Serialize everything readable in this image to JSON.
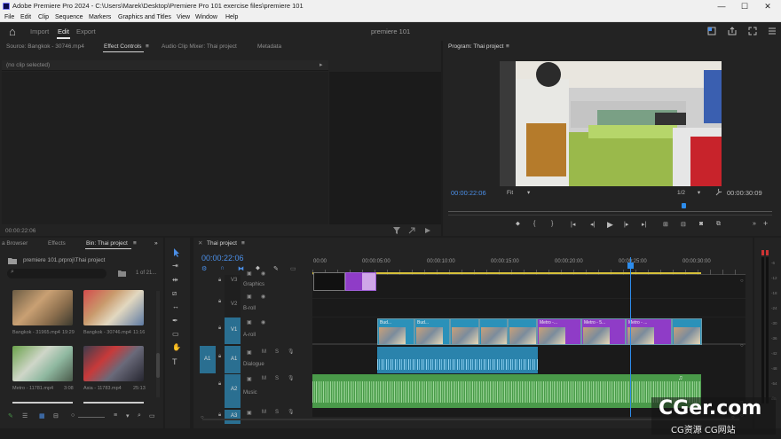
{
  "window": {
    "title": "Adobe Premiere Pro 2024 - C:\\Users\\Marek\\Desktop\\Premiere Pro 101 exercise files\\premiere 101",
    "minimize": "—",
    "maximize": "☐",
    "close": "✕"
  },
  "menu": [
    "File",
    "Edit",
    "Clip",
    "Sequence",
    "Markers",
    "Graphics and Titles",
    "View",
    "Window",
    "Help"
  ],
  "header": {
    "home": "⌂",
    "import": "Import",
    "edit": "Edit",
    "export": "Export",
    "project_name": "premiere 101"
  },
  "source_panel": {
    "tabs": [
      "Source: Bangkok - 30746.mp4",
      "Effect Controls",
      "Audio Clip Mixer: Thai project",
      "Metadata"
    ],
    "menu_glyph": "≡",
    "no_clip": "(no clip selected)",
    "timecode": "00:00:22:06"
  },
  "program_panel": {
    "tab": "Program: Thai project",
    "menu_glyph": "≡",
    "timecode": "00:00:22:06",
    "fit": "Fit",
    "quality": "1/2",
    "duration": "00:00:30:09"
  },
  "bin_panel": {
    "tabs": [
      "a Browser",
      "Effects",
      "Bin: Thai project"
    ],
    "menu_glyph": "≡",
    "expand": "»",
    "path": "premiere 101.prproj\\Thai project",
    "page": "1 of 21...",
    "items": [
      {
        "name": "Bangkok - 31965.mp4",
        "duration": "19:29"
      },
      {
        "name": "Bangkok - 30746.mp4",
        "duration": "11:16"
      },
      {
        "name": "Metro - 11781.mp4",
        "duration": "3:08"
      },
      {
        "name": "Asia - 11783.mp4",
        "duration": "25:13"
      }
    ]
  },
  "timeline": {
    "tab": "Thai project",
    "menu_glyph": "≡",
    "timecode": "00:00:22:06",
    "playhead_progress": 0.736,
    "ruler": [
      "00:00",
      "00:00:05:00",
      "00:00:10:00",
      "00:00:15:00",
      "00:00:20:00",
      "00:00:25:00",
      "00:00:30:00"
    ],
    "tracks": [
      {
        "id": "V3",
        "name": "Graphics"
      },
      {
        "id": "V2",
        "name": "B-roll"
      },
      {
        "id": "V1",
        "name": "A-roll"
      },
      {
        "id": "A1",
        "name": "Dialogue"
      },
      {
        "id": "A2",
        "name": "Music"
      },
      {
        "id": "A3",
        "name": ""
      }
    ],
    "src_v": "V1",
    "src_a": "A1",
    "clips_a_roll": [
      "Bud...",
      "Bud...",
      "",
      "",
      "",
      "Metro -...",
      "Metro - 5...",
      "Metro - ...",
      ""
    ],
    "track_btn_m": "M",
    "track_btn_s": "S",
    "volume_ticks": [
      "-6",
      "-12",
      "-18",
      "-24",
      "-30",
      "-36",
      "-42",
      "-48",
      "-54",
      "dB"
    ]
  },
  "watermark": {
    "title": "CGer.com",
    "subtitle": "CG资源 CG网站"
  },
  "colors": {
    "accent_blue": "#2d8ceb",
    "timecode_blue": "#4b8fe8",
    "clip_purple": "#8f3cc7",
    "clip_teal": "#2b91b9",
    "audio_green": "#4a9a4a",
    "dialogue_blue": "#2a83ac",
    "track_yellow": "#d6c13a"
  }
}
